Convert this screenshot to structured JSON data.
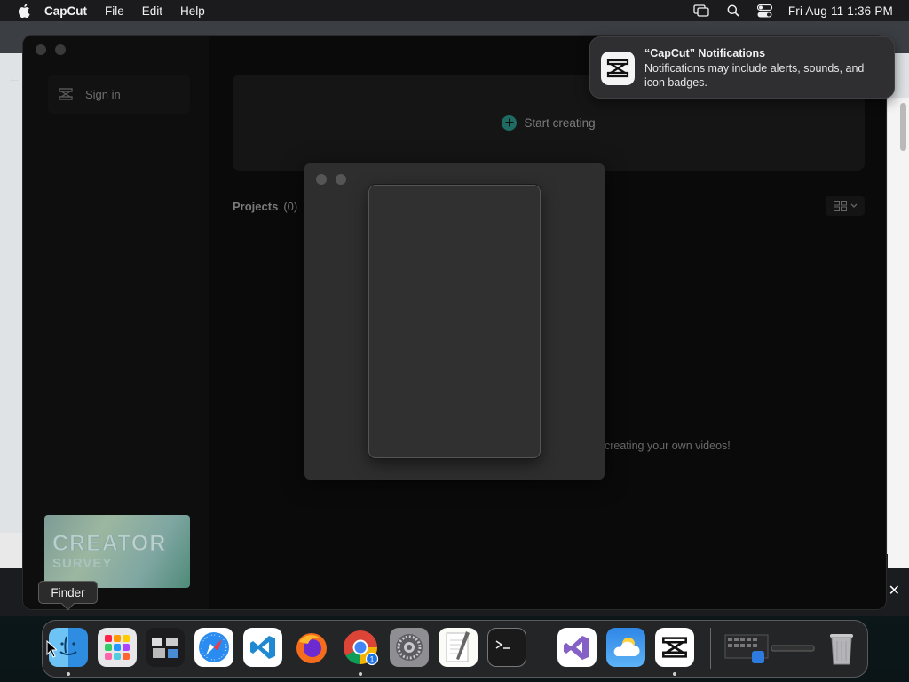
{
  "menubar": {
    "app_name": "CapCut",
    "items": [
      "File",
      "Edit",
      "Help"
    ],
    "clock": "Fri Aug 11  1:36 PM"
  },
  "capcut": {
    "sign_in": "Sign in",
    "start_creating": "Start creating",
    "projects_label": "Projects",
    "projects_count": "(0)",
    "empty_message": "creating your own videos!",
    "survey_line1": "CREATOR",
    "survey_line2": "SURVEY"
  },
  "notification": {
    "title": "“CapCut” Notifications",
    "body": "Notifications may include alerts, sounds, and icon badges."
  },
  "tooltip": "Finder",
  "dock": {
    "apps": [
      "finder-icon",
      "launchpad-icon",
      "mission-control-icon",
      "safari-icon",
      "vscode-icon",
      "firefox-icon",
      "chrome-icon",
      "system-settings-icon",
      "textedit-icon",
      "terminal-icon",
      "visual-studio-icon",
      "weather-icon",
      "capcut-icon",
      "downloads-stack-icon",
      "trash-icon"
    ],
    "chrome_badge": "1"
  }
}
